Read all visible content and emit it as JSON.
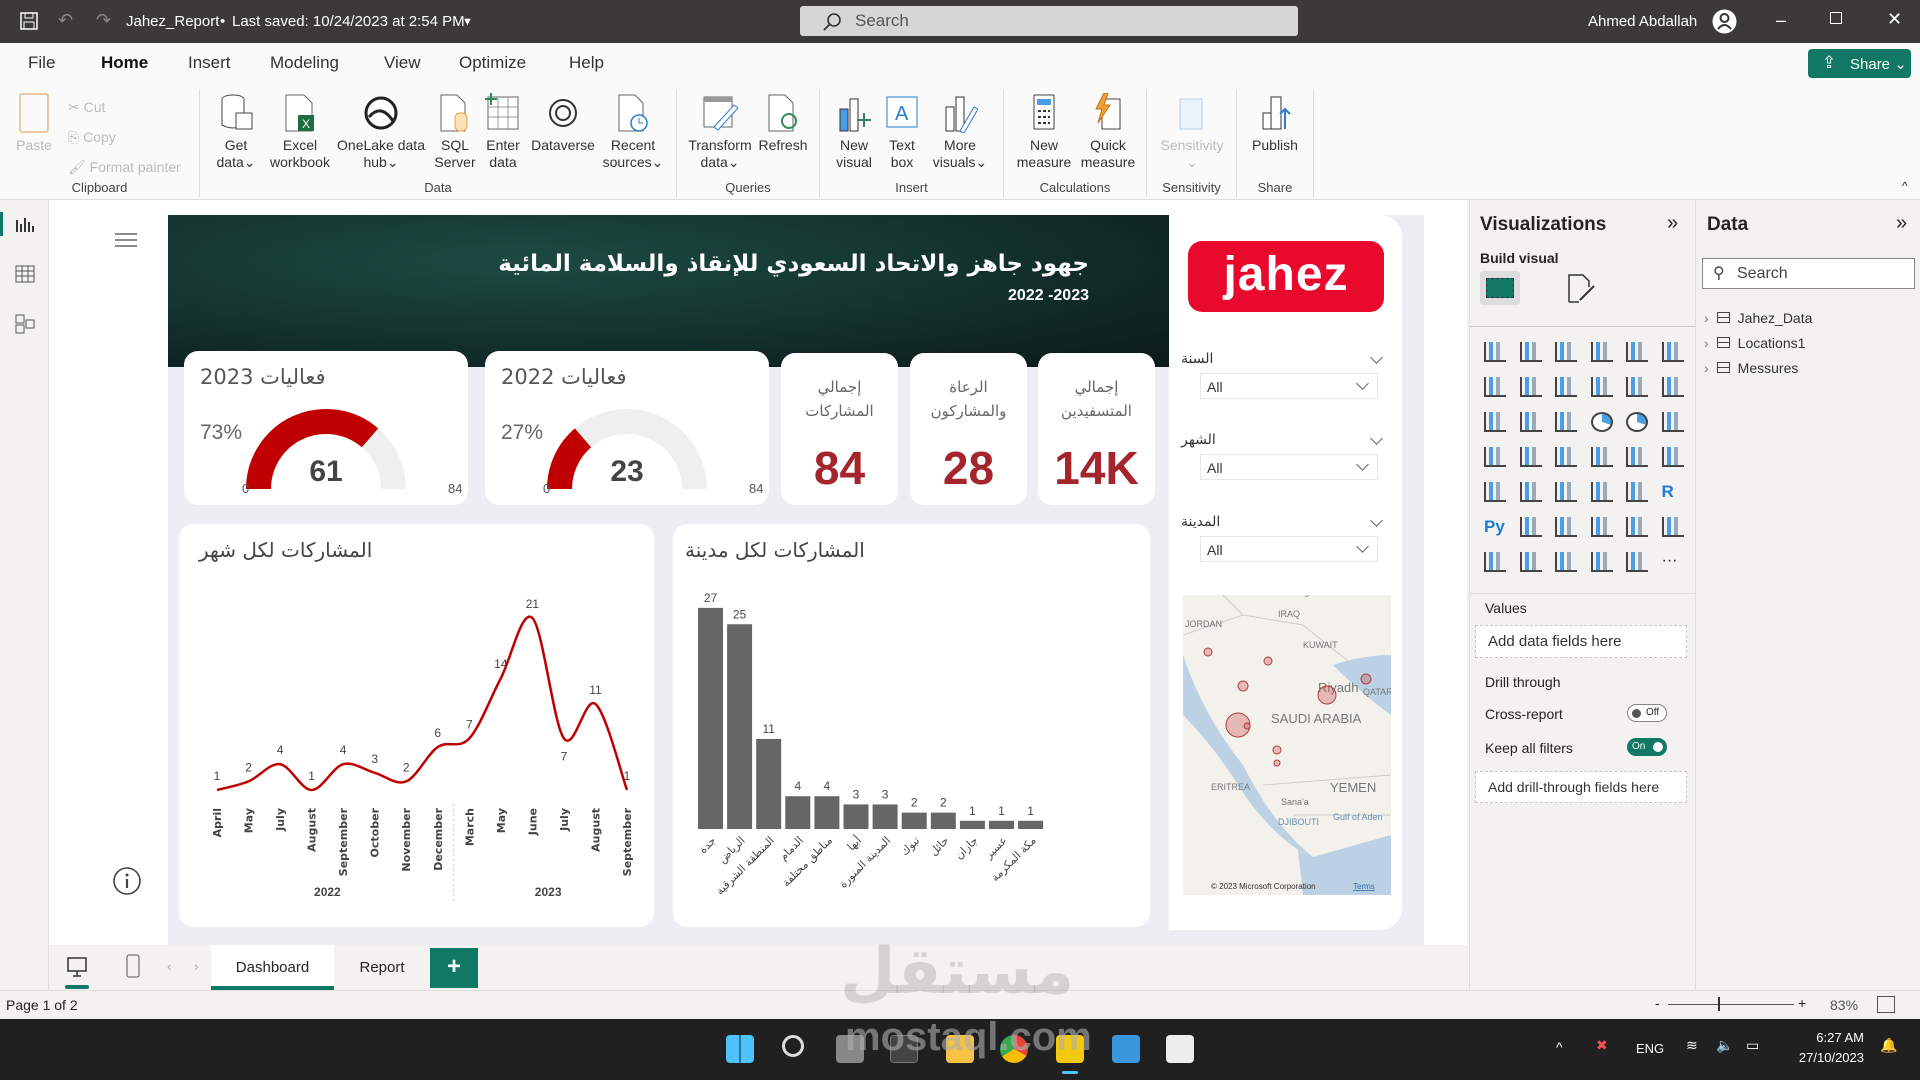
{
  "titlebar": {
    "title": "Jahez_Report",
    "saved": "Last saved: 10/24/2023 at 2:54 PM",
    "search_placeholder": "Search",
    "user": "Ahmed Abdallah"
  },
  "menu": {
    "file": "File",
    "home": "Home",
    "insert": "Insert",
    "modeling": "Modeling",
    "view": "View",
    "optimize": "Optimize",
    "help": "Help",
    "share": "Share"
  },
  "ribbon": {
    "clipboard": {
      "label": "Clipboard",
      "paste": "Paste",
      "cut": "Cut",
      "copy": "Copy",
      "format_painter": "Format painter"
    },
    "data": {
      "label": "Data",
      "get_data": [
        "Get",
        "data"
      ],
      "excel": [
        "Excel",
        "workbook"
      ],
      "onelake": [
        "OneLake data",
        "hub"
      ],
      "sql": [
        "SQL",
        "Server"
      ],
      "enter": [
        "Enter",
        "data"
      ],
      "dataverse": "Dataverse",
      "recent": [
        "Recent",
        "sources"
      ]
    },
    "queries": {
      "label": "Queries",
      "transform": [
        "Transform",
        "data"
      ],
      "refresh": "Refresh"
    },
    "insert": {
      "label": "Insert",
      "new_visual": [
        "New",
        "visual"
      ],
      "text_box": [
        "Text",
        "box"
      ],
      "more_visuals": [
        "More",
        "visuals"
      ]
    },
    "calculations": {
      "label": "Calculations",
      "new_measure": [
        "New",
        "measure"
      ],
      "quick_measure": [
        "Quick",
        "measure"
      ]
    },
    "sensitivity": {
      "label": "Sensitivity",
      "sensitivity": "Sensitivity"
    },
    "share": {
      "label": "Share",
      "publish": "Publish"
    }
  },
  "report": {
    "title": "جهود جاهز والاتحاد السعودي للإنقاذ والسلامة المائية",
    "subtitle": "2022 -2023",
    "logo": "jahez",
    "gauges": [
      {
        "title": "فعاليات 2023",
        "value": 61,
        "max": 84,
        "min": 0,
        "percent": "73%",
        "value_label": "61",
        "min_label": "0",
        "max_label": "84"
      },
      {
        "title": "فعاليات 2022",
        "value": 23,
        "max": 84,
        "min": 0,
        "percent": "27%",
        "value_label": "23",
        "min_label": "0",
        "max_label": "84"
      }
    ],
    "kpis": [
      {
        "title": [
          "إجمالي",
          "المشاركات"
        ],
        "value": "84"
      },
      {
        "title": [
          "الرعاة",
          "والمشاركون"
        ],
        "value": "28"
      },
      {
        "title": [
          "إجمالي",
          "المتسفيدين"
        ],
        "value": "14K"
      }
    ],
    "slicers": [
      {
        "label": "السنة",
        "value": "All"
      },
      {
        "label": "الشهر",
        "value": "All"
      },
      {
        "label": "المدينة",
        "value": "All"
      }
    ],
    "map": {
      "labels": [
        "IRAQ",
        "JORDAN",
        "KUWAIT",
        "Riyadh",
        "QATAR",
        "SAUDI ARABIA",
        "ERITREA",
        "YEMEN",
        "Sana'a",
        "DJIBOUTI",
        "Gulf of Aden",
        "Baghdad"
      ],
      "copyright": "© 2023 Microsoft Corporation",
      "terms": "Terms"
    }
  },
  "chart_data": [
    {
      "type": "line",
      "title": "المشاركات لكل شهر",
      "x": [
        "April",
        "May",
        "July",
        "August",
        "September",
        "October",
        "November",
        "December",
        "March",
        "May",
        "June",
        "July",
        "August",
        "September"
      ],
      "groups": [
        {
          "label": "2022",
          "count": 8
        },
        {
          "label": "2023",
          "count": 6
        }
      ],
      "values": [
        1,
        2,
        4,
        1,
        4,
        3,
        2,
        6,
        7,
        14,
        21,
        7,
        11,
        1
      ],
      "color": "#c00000"
    },
    {
      "type": "bar",
      "title": "المشاركات لكل مدينة",
      "categories": [
        "جدة",
        "الرياض",
        "المنطقة الشرقية",
        "الدمام",
        "مناطق مختلفة",
        "أبها",
        "المدينة المنورة",
        "تبوك",
        "حائل",
        "جازان",
        "عسير",
        "مكة المكرمة"
      ],
      "values": [
        27,
        25,
        11,
        4,
        4,
        3,
        3,
        2,
        2,
        1,
        1,
        1
      ],
      "color": "#666666"
    }
  ],
  "viz": {
    "title": "Visualizations",
    "build": "Build visual",
    "values": "Values",
    "add_fields": "Add data fields here",
    "drill": "Drill through",
    "cross": "Cross-report",
    "cross_state": "Off",
    "keep": "Keep all filters",
    "keep_state": "On",
    "add_drill": "Add drill-through fields here"
  },
  "datapane": {
    "title": "Data",
    "search": "Search",
    "tables": [
      "Jahez_Data",
      "Locations1",
      "Messures"
    ]
  },
  "pages": {
    "tabs": [
      "Dashboard",
      "Report"
    ],
    "add": "+"
  },
  "status": {
    "page": "Page 1 of 2",
    "zoom": "83%"
  },
  "taskbar": {
    "lang": "ENG",
    "time": "6:27 AM",
    "date": "27/10/2023"
  },
  "watermark": {
    "ar": "مستقل",
    "en": "mostaql.com"
  }
}
